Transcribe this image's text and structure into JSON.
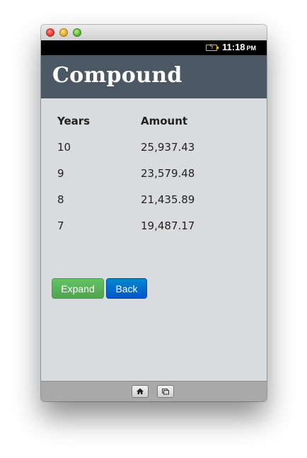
{
  "statusbar": {
    "time": "11:18",
    "ampm": "PM"
  },
  "header": {
    "title": "Compound"
  },
  "table": {
    "headers": [
      "Years",
      "Amount"
    ],
    "rows": [
      [
        "10",
        "25,937.43"
      ],
      [
        "9",
        "23,579.48"
      ],
      [
        "8",
        "21,435.89"
      ],
      [
        "7",
        "19,487.17"
      ]
    ]
  },
  "buttons": {
    "expand_label": "Expand",
    "back_label": "Back"
  },
  "icons": {
    "window_controls": [
      "close-icon",
      "minimize-icon",
      "zoom-icon"
    ],
    "status": [
      "battery-charging-icon"
    ],
    "nav": [
      "home-icon",
      "recent-apps-icon"
    ]
  },
  "colors": {
    "header": "#4b5863",
    "expand_button": "#51a351",
    "back_button": "#0055cc"
  }
}
